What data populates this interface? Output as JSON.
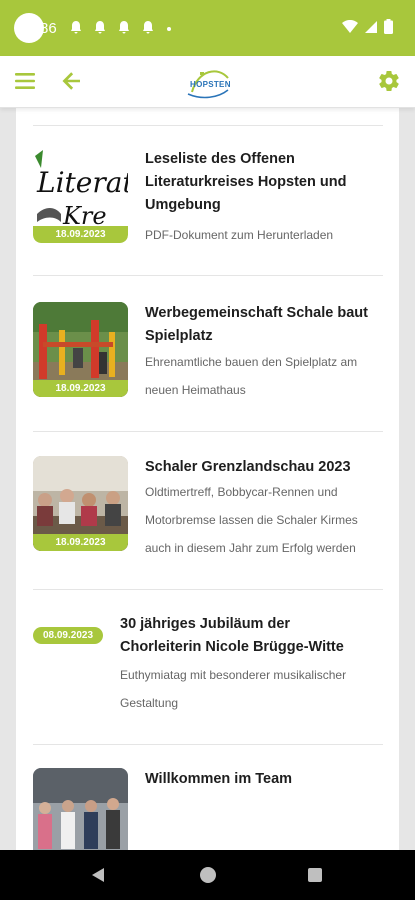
{
  "status_bar": {
    "time": "86",
    "notification_icons": [
      "bell-icon",
      "bell-icon",
      "bell-icon",
      "bell-icon"
    ],
    "system_icons": [
      "wifi-icon",
      "signal-icon",
      "battery-icon"
    ]
  },
  "app_bar": {
    "logo_text": "HOPSTEN",
    "menu_icon": "hamburger-menu-icon",
    "back_icon": "arrow-left-icon",
    "settings_icon": "gear-icon"
  },
  "colors": {
    "accent": "#a8c73c",
    "title": "#1e1e1e",
    "desc": "#666666"
  },
  "news": [
    {
      "title": "Leseliste des Offenen Literaturkreises Hopsten und Umgebung",
      "description": "PDF-Dokument zum Herunterladen",
      "date": "18.09.2023",
      "thumb_text": "Literat"
    },
    {
      "title": "Werbegemeinschaft Schale baut Spielplatz",
      "description": "Ehrenamtliche bauen den Spielplatz am neuen Heimathaus",
      "date": "18.09.2023"
    },
    {
      "title": "Schaler Grenzlandschau 2023",
      "description": "Oldtimertreff, Bobbycar-Rennen und Motorbremse lassen die Schaler Kirmes auch in diesem Jahr zum Erfolg werden",
      "date": "18.09.2023"
    },
    {
      "title": "30 jähriges Jubiläum der Chorleiterin Nicole Brügge-Witte",
      "description": "Euthymiatag mit besonderer musikalischer Gestaltung",
      "date": "08.09.2023"
    },
    {
      "title": "Willkommen im Team",
      "description": "",
      "date": ""
    }
  ]
}
